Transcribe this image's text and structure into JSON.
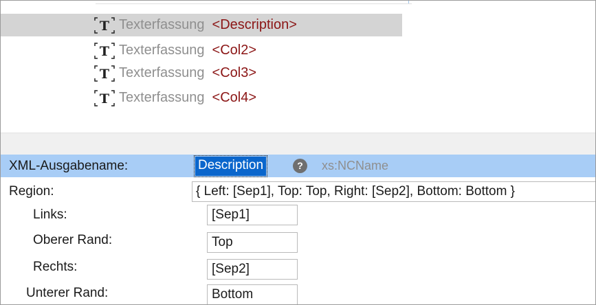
{
  "tree": {
    "items": [
      {
        "kind": "Texterfassung",
        "name": "<Description>",
        "selected": true
      },
      {
        "kind": "Texterfassung",
        "name": "<Col2>",
        "selected": false
      },
      {
        "kind": "Texterfassung",
        "name": "<Col3>",
        "selected": false
      },
      {
        "kind": "Texterfassung",
        "name": "<Col4>",
        "selected": false
      }
    ]
  },
  "properties": {
    "xml_name": {
      "label": "XML-Ausgabename:",
      "value": "Description",
      "type_hint": "xs:NCName",
      "help": "?"
    },
    "region": {
      "label": "Region:",
      "value": "{ Left: [Sep1], Top: Top, Right: [Sep2], Bottom: Bottom }"
    },
    "left": {
      "label": "Links:",
      "value": "[Sep1]"
    },
    "top": {
      "label": "Oberer Rand:",
      "value": "Top"
    },
    "right": {
      "label": "Rechts:",
      "value": "[Sep2]"
    },
    "bottom": {
      "label": "Unterer Rand:",
      "value": "Bottom"
    }
  }
}
